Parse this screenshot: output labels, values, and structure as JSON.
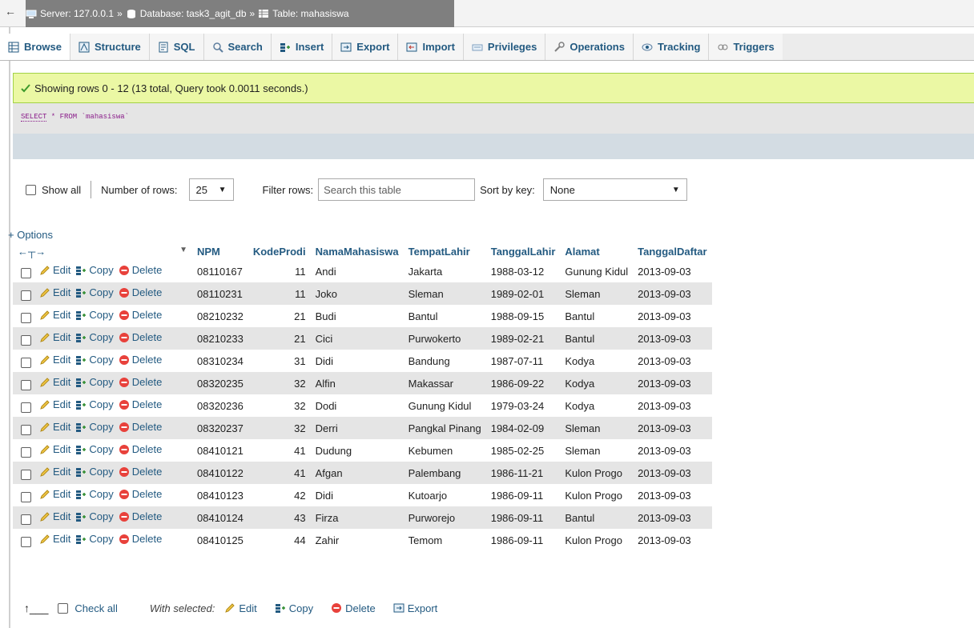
{
  "breadcrumb": {
    "back": "←",
    "server_label": "Server: 127.0.0.1",
    "database_label": "Database: task3_agit_db",
    "table_label": "Table: mahasiswa",
    "sep": "»"
  },
  "tabs": [
    {
      "label": "Browse",
      "icon": "browse-icon",
      "active": true
    },
    {
      "label": "Structure",
      "icon": "structure-icon"
    },
    {
      "label": "SQL",
      "icon": "sql-icon"
    },
    {
      "label": "Search",
      "icon": "search-icon"
    },
    {
      "label": "Insert",
      "icon": "insert-icon"
    },
    {
      "label": "Export",
      "icon": "export-icon"
    },
    {
      "label": "Import",
      "icon": "import-icon"
    },
    {
      "label": "Privileges",
      "icon": "privileges-icon"
    },
    {
      "label": "Operations",
      "icon": "operations-icon"
    },
    {
      "label": "Tracking",
      "icon": "tracking-icon"
    },
    {
      "label": "Triggers",
      "icon": "triggers-icon"
    }
  ],
  "message": {
    "text": "Showing rows 0 - 12 (13 total, Query took 0.0011 seconds.)"
  },
  "query": {
    "keyword": "SELECT",
    "rest": " * FROM `mahasiswa`"
  },
  "nav": {
    "show_all": "Show all",
    "num_rows_label": "Number of rows:",
    "num_rows_value": "25",
    "filter_label": "Filter rows:",
    "filter_placeholder": "Search this table",
    "sort_label": "Sort by key:",
    "sort_value": "None"
  },
  "options_link": "+ Options",
  "table": {
    "columns": [
      "NPM",
      "KodeProdi",
      "NamaMahasiswa",
      "TempatLahir",
      "TanggalLahir",
      "Alamat",
      "TanggalDaftar"
    ],
    "actions": {
      "edit": "Edit",
      "copy": "Copy",
      "delete": "Delete"
    },
    "rows": [
      [
        "08110167",
        "11",
        "Andi",
        "Jakarta",
        "1988-03-12",
        "Gunung Kidul",
        "2013-09-03"
      ],
      [
        "08110231",
        "11",
        "Joko",
        "Sleman",
        "1989-02-01",
        "Sleman",
        "2013-09-03"
      ],
      [
        "08210232",
        "21",
        "Budi",
        "Bantul",
        "1988-09-15",
        "Bantul",
        "2013-09-03"
      ],
      [
        "08210233",
        "21",
        "Cici",
        "Purwokerto",
        "1989-02-21",
        "Bantul",
        "2013-09-03"
      ],
      [
        "08310234",
        "31",
        "Didi",
        "Bandung",
        "1987-07-11",
        "Kodya",
        "2013-09-03"
      ],
      [
        "08320235",
        "32",
        "Alfin",
        "Makassar",
        "1986-09-22",
        "Kodya",
        "2013-09-03"
      ],
      [
        "08320236",
        "32",
        "Dodi",
        "Gunung Kidul",
        "1979-03-24",
        "Kodya",
        "2013-09-03"
      ],
      [
        "08320237",
        "32",
        "Derri",
        "Pangkal Pinang",
        "1984-02-09",
        "Sleman",
        "2013-09-03"
      ],
      [
        "08410121",
        "41",
        "Dudung",
        "Kebumen",
        "1985-02-25",
        "Sleman",
        "2013-09-03"
      ],
      [
        "08410122",
        "41",
        "Afgan",
        "Palembang",
        "1986-11-21",
        "Kulon Progo",
        "2013-09-03"
      ],
      [
        "08410123",
        "42",
        "Didi",
        "Kutoarjo",
        "1986-09-11",
        "Kulon Progo",
        "2013-09-03"
      ],
      [
        "08410124",
        "43",
        "Firza",
        "Purworejo",
        "1986-09-11",
        "Bantul",
        "2013-09-03"
      ],
      [
        "08410125",
        "44",
        "Zahir",
        "Temom",
        "1986-09-11",
        "Kulon Progo",
        "2013-09-03"
      ]
    ]
  },
  "footer": {
    "check_all": "Check all",
    "with_selected": "With selected:",
    "edit": "Edit",
    "copy": "Copy",
    "delete": "Delete",
    "export": "Export"
  },
  "colors": {
    "link": "#235a81",
    "success_bg": "#ebf8a4",
    "row_alt": "#e5e5e5"
  }
}
